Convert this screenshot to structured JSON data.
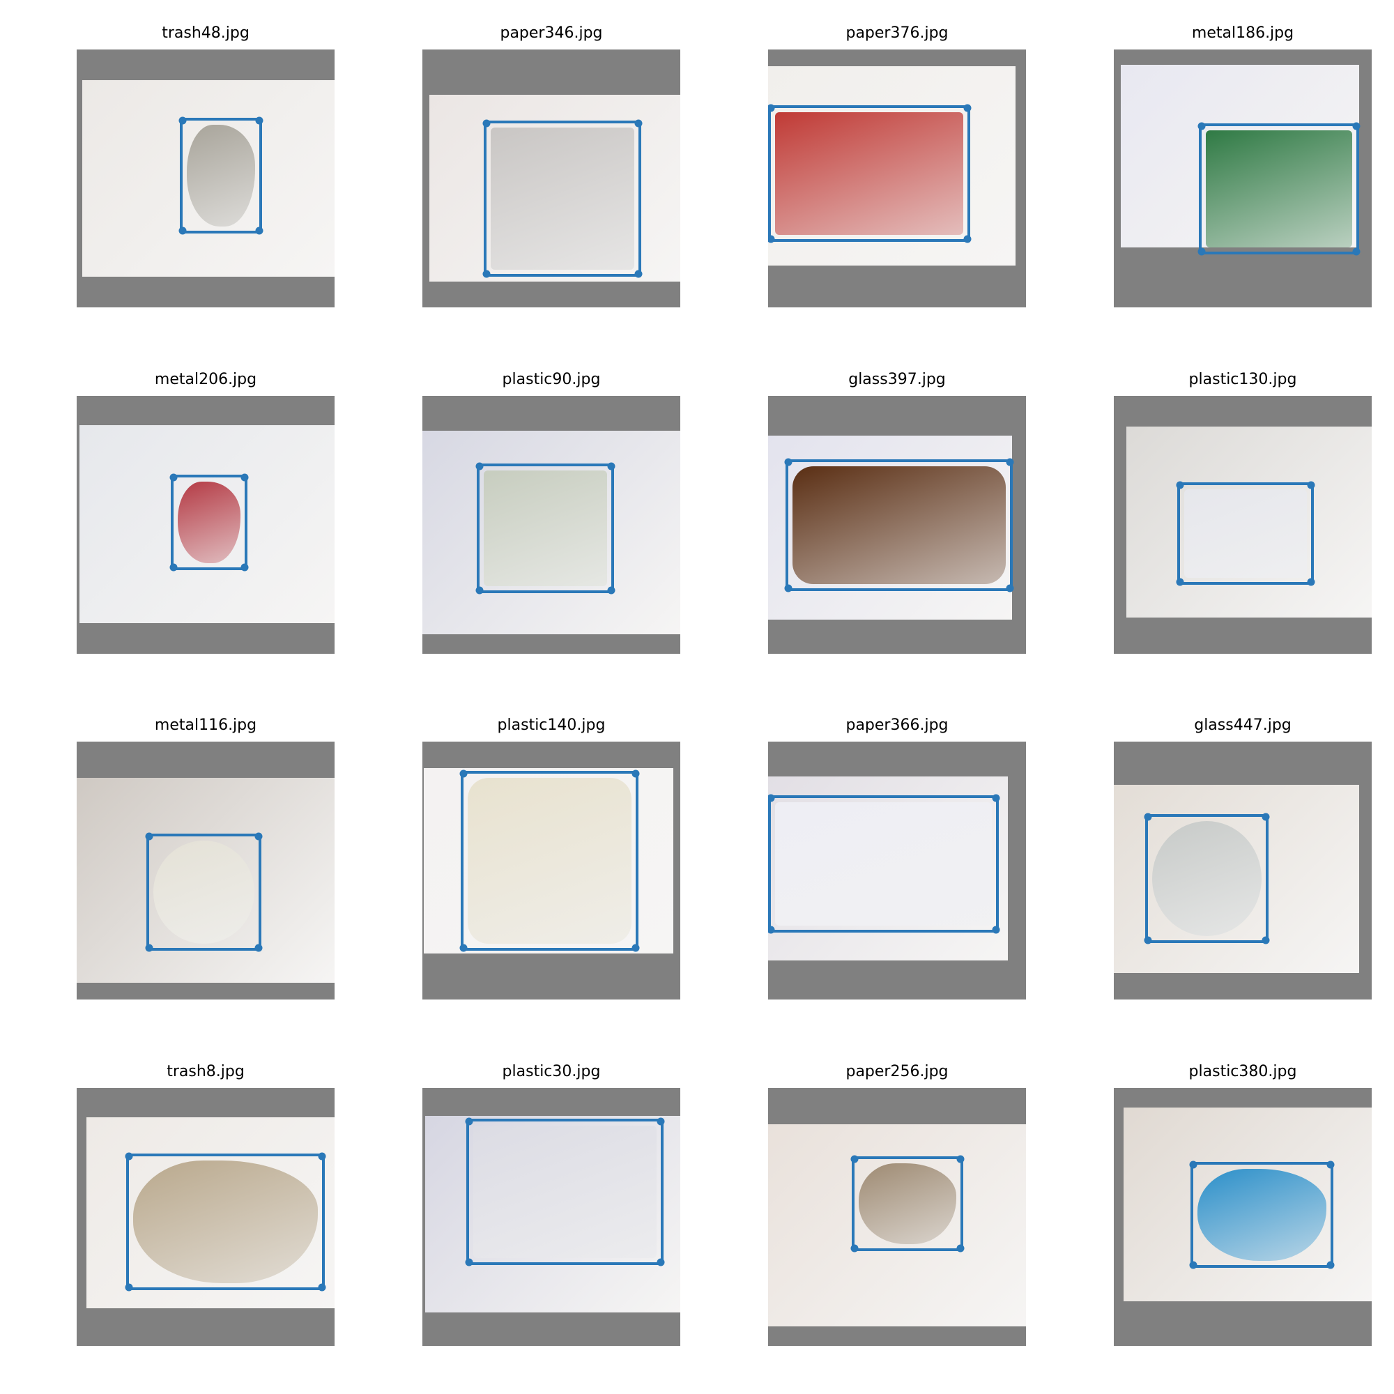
{
  "figure": {
    "panels": [
      {
        "title": "trash48.jpg",
        "category": "trash",
        "photo_color": "#ece9e6",
        "object_color": "#a8a49a",
        "bbox_color": "#2a78b8"
      },
      {
        "title": "paper346.jpg",
        "category": "paper",
        "photo_color": "#ebe6e4",
        "object_color": "#c9c6c4",
        "bbox_color": "#2a78b8"
      },
      {
        "title": "paper376.jpg",
        "category": "paper",
        "photo_color": "#f1efec",
        "object_color": "#c03a35",
        "bbox_color": "#2a78b8"
      },
      {
        "title": "metal186.jpg",
        "category": "metal",
        "photo_color": "#e8e8f1",
        "object_color": "#2f7a44",
        "bbox_color": "#2a78b8"
      },
      {
        "title": "metal206.jpg",
        "category": "metal",
        "photo_color": "#e6e8ec",
        "object_color": "#b43a44",
        "bbox_color": "#2a78b8"
      },
      {
        "title": "plastic90.jpg",
        "category": "plastic",
        "photo_color": "#d7d8e3",
        "object_color": "#c7cdbf",
        "bbox_color": "#2a78b8"
      },
      {
        "title": "glass397.jpg",
        "category": "glass",
        "photo_color": "#e3e3ee",
        "object_color": "#5a2e13",
        "bbox_color": "#2a78b8"
      },
      {
        "title": "plastic130.jpg",
        "category": "plastic",
        "photo_color": "#dcdad7",
        "object_color": "#e6e7ec",
        "bbox_color": "#2a78b8"
      },
      {
        "title": "metal116.jpg",
        "category": "metal",
        "photo_color": "#cfc9c3",
        "object_color": "#e4e1d6",
        "bbox_color": "#2a78b8"
      },
      {
        "title": "plastic140.jpg",
        "category": "plastic",
        "photo_color": "#f4f2f2",
        "object_color": "#e8e2cf",
        "bbox_color": "#2a78b8"
      },
      {
        "title": "paper366.jpg",
        "category": "paper",
        "photo_color": "#e2dfe5",
        "object_color": "#eeeef4",
        "bbox_color": "#2a78b8"
      },
      {
        "title": "glass447.jpg",
        "category": "glass",
        "photo_color": "#e3ddd6",
        "object_color": "#c7cac8",
        "bbox_color": "#2a78b8"
      },
      {
        "title": "trash8.jpg",
        "category": "trash",
        "photo_color": "#eeeae6",
        "object_color": "#b9a88c",
        "bbox_color": "#2a78b8"
      },
      {
        "title": "plastic30.jpg",
        "category": "plastic",
        "photo_color": "#d6d6e2",
        "object_color": "#dcdce4",
        "bbox_color": "#2a78b8"
      },
      {
        "title": "paper256.jpg",
        "category": "paper",
        "photo_color": "#e9e1db",
        "object_color": "#9e8a72",
        "bbox_color": "#2a78b8"
      },
      {
        "title": "plastic380.jpg",
        "category": "plastic",
        "photo_color": "#e0d9d2",
        "object_color": "#2b8fc9",
        "bbox_color": "#2a78b8"
      }
    ]
  }
}
